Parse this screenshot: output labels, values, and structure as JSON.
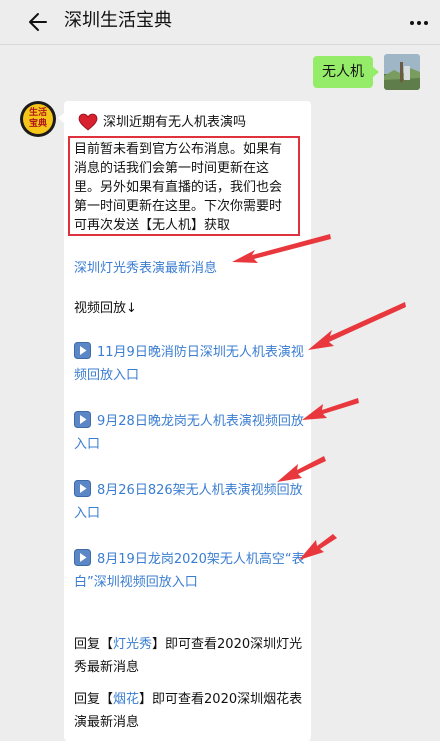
{
  "header": {
    "title": "深圳生活宝典"
  },
  "user_message": {
    "text": "无人机"
  },
  "reply": {
    "heading": "深圳近期有无人机表演吗",
    "notice": "目前暂未看到官方公布消息。如果有消息的话我们会第一时间更新在这里。另外如果有直播的话，我们也会第一时间更新在这里。下次你需要时可再次发送【无人机】获取",
    "link_light_show": "深圳灯光秀表演最新消息",
    "replay_label": "视频回放↓",
    "videos": [
      "11月9日晚消防日深圳无人机表演视频回放入口",
      "9月28日晚龙岗无人机表演视频回放入口",
      "8月26日826架无人机表演视频回放入口",
      "8月19日龙岗2020架无人机高空“表白”深圳视频回放入口"
    ],
    "tip1": {
      "prefix": "回复【",
      "keyword": "灯光秀",
      "suffix": "】即可查看2020深圳灯光秀最新消息"
    },
    "tip2": {
      "prefix": "回复【",
      "keyword": "烟花",
      "suffix": "】即可查看2020深圳烟花表演最新消息"
    }
  },
  "colors": {
    "bubble_green": "#95ec69",
    "link_blue": "#3a7dd1",
    "highlight_red": "#e0323c"
  },
  "icons": [
    "back-arrow-icon",
    "more-icon",
    "heart-icon",
    "play-icon",
    "annotation-arrow"
  ]
}
